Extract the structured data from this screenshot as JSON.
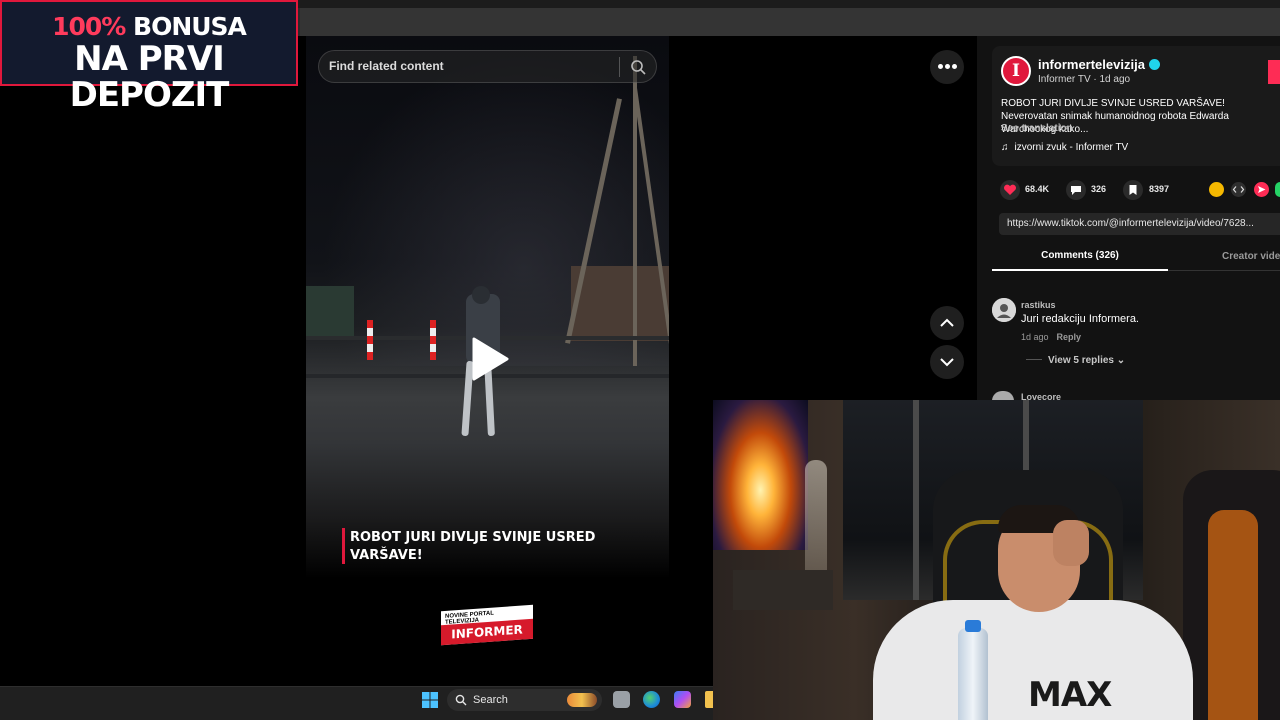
{
  "promo": {
    "pct": "100%",
    "line1_rest": " BONUSA",
    "line2": "NA PRVI DEPOZIT"
  },
  "video": {
    "search_placeholder": "Find related content",
    "caption_line1": "ROBOT JURI DIVLJE SVINJE USRED",
    "caption_line2": "VARŠAVE!",
    "logo_top": "NOVINE PORTAL TELEVIZIJA",
    "logo_brand": "INFORMER"
  },
  "author": {
    "avatar_letter": "I",
    "handle": "informertelevizija",
    "subline": "Informer TV · 1d ago",
    "description": "ROBOT JURI DIVLJE SVINJE USRED VARŠAVE! Neverovatan snimak humanoidnog robota Edwarda Warchockog kako...",
    "see_translation": "See translation",
    "music": "izvorni zvuk - Informer TV"
  },
  "stats": {
    "likes": "68.4K",
    "comments": "326",
    "saves": "8397"
  },
  "link": "https://www.tiktok.com/@informertelevizija/video/7628...",
  "tabs": {
    "comments": "Comments (326)",
    "creator": "Creator vide"
  },
  "comments": [
    {
      "user": "rastikus",
      "text": "Juri redakciju Informera.",
      "time": "1d ago",
      "reply": "Reply",
      "view_replies": "View 5 replies"
    },
    {
      "user": "Lovecore"
    }
  ],
  "webcam": {
    "shirt_print": "MAX"
  },
  "taskbar": {
    "search_label": "Search"
  },
  "colors": {
    "accent": "#fe2c55",
    "brand_red": "#e0183c",
    "verified": "#20d5ec"
  }
}
